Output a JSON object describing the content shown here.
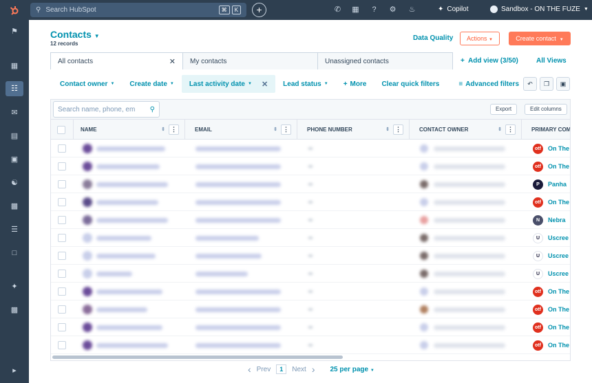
{
  "topbar": {
    "search_placeholder": "Search HubSpot",
    "kbd1": "⌘",
    "kbd2": "K",
    "copilot": "Copilot",
    "sandbox": "Sandbox - ON THE FUZE"
  },
  "page": {
    "title": "Contacts",
    "records": "12 records",
    "data_quality": "Data Quality",
    "actions": "Actions",
    "create": "Create contact"
  },
  "tabs": [
    "All contacts",
    "My contacts",
    "Unassigned contacts"
  ],
  "add_view": "Add view (3/50)",
  "all_views": "All Views",
  "filters": {
    "owner": "Contact owner",
    "create": "Create date",
    "activity": "Last activity date",
    "lead": "Lead status",
    "more": "More",
    "clear": "Clear quick filters",
    "advanced": "Advanced filters"
  },
  "grid": {
    "search_placeholder": "Search name, phone, em",
    "export": "Export",
    "edit_columns": "Edit columns"
  },
  "columns": [
    "NAME",
    "EMAIL",
    "PHONE NUMBER",
    "CONTACT OWNER",
    "PRIMARY COM"
  ],
  "rows": [
    {
      "company": "On The",
      "logo": "otf",
      "color": "#e0301e"
    },
    {
      "company": "On The",
      "logo": "otf",
      "color": "#e0301e"
    },
    {
      "company": "Panha",
      "logo": "P",
      "color": "#1b1b3a"
    },
    {
      "company": "On The",
      "logo": "otf",
      "color": "#e0301e"
    },
    {
      "company": "Nebra",
      "logo": "N",
      "color": "#4a4f6a"
    },
    {
      "company": "Uscree",
      "logo": "U",
      "color": "#ffffff"
    },
    {
      "company": "Uscree",
      "logo": "U",
      "color": "#ffffff"
    },
    {
      "company": "Uscree",
      "logo": "U",
      "color": "#ffffff"
    },
    {
      "company": "On The",
      "logo": "otf",
      "color": "#e0301e"
    },
    {
      "company": "On The",
      "logo": "otf",
      "color": "#e0301e"
    },
    {
      "company": "On The",
      "logo": "otf",
      "color": "#e0301e"
    },
    {
      "company": "On The",
      "logo": "otf",
      "color": "#e0301e"
    }
  ],
  "pager": {
    "prev": "Prev",
    "page": "1",
    "next": "Next",
    "per_page": "25 per page"
  }
}
